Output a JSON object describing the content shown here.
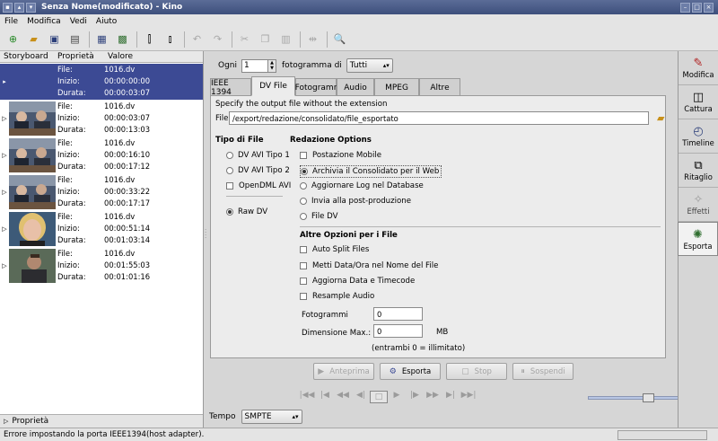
{
  "window": {
    "title": "Senza Nome(modificato) - Kino"
  },
  "menu": [
    "File",
    "Modifica",
    "Vedi",
    "Aiuto"
  ],
  "storyboard": {
    "headers": [
      "Storyboard",
      "Proprietà",
      "Valore"
    ],
    "labels": {
      "file": "File:",
      "start": "Inizio:",
      "dur": "Durata:"
    },
    "clips": [
      {
        "file": "1016.dv",
        "start": "00:00:00:00",
        "dur": "00:00:03:07",
        "thumb": "none",
        "selected": true
      },
      {
        "file": "1016.dv",
        "start": "00:00:03:07",
        "dur": "00:00:13:03",
        "thumb": "meeting"
      },
      {
        "file": "1016.dv",
        "start": "00:00:16:10",
        "dur": "00:00:17:12",
        "thumb": "meeting"
      },
      {
        "file": "1016.dv",
        "start": "00:00:33:22",
        "dur": "00:00:17:17",
        "thumb": "meeting"
      },
      {
        "file": "1016.dv",
        "start": "00:00:51:14",
        "dur": "00:01:03:14",
        "thumb": "woman"
      },
      {
        "file": "1016.dv",
        "start": "00:01:55:03",
        "dur": "00:01:01:16",
        "thumb": "man"
      }
    ],
    "footer": "Proprietà"
  },
  "controls": {
    "ogni_label": "Ogni",
    "ogni_value": "1",
    "frame_label": "fotogramma di",
    "frame_select": "Tutti"
  },
  "tabs": [
    "IEEE 1394",
    "DV File",
    "Fotogramr",
    "Audio",
    "MPEG",
    "Altre"
  ],
  "export": {
    "hint": "Specify the output file without the extension",
    "file_label": "File",
    "file_value": "/export/redazione/consolidato/file_esportato",
    "tipo_title": "Tipo di File",
    "tipo": [
      "DV AVI Tipo 1",
      "DV AVI Tipo 2"
    ],
    "opendml": "OpenDML AVI",
    "raw": "Raw DV",
    "red_title": "Redazione Options",
    "red_options": [
      "Postazione Mobile",
      "Archivia il Consolidato per il Web",
      "Aggiornare Log nel Database",
      "Invia alla post-produzione",
      "File DV"
    ],
    "altre_title": "Altre Opzioni per i File",
    "altre": [
      "Auto Split Files",
      "Metti Data/Ora nel Nome del File",
      "Aggiorna Data e Timecode",
      "Resample Audio"
    ],
    "fotogrammi_label": "Fotogrammi",
    "fotogrammi_value": "0",
    "dim_label": "Dimensione Max.:",
    "dim_value": "0",
    "dim_unit": "MB",
    "dim_note": "(entrambi 0 = illimitato)"
  },
  "buttons": {
    "anteprima": "Anteprima",
    "esporta": "Esporta",
    "stop": "Stop",
    "sospendi": "Sospendi"
  },
  "tempo": {
    "label": "Tempo",
    "value": "SMPTE"
  },
  "side": [
    "Modifica",
    "Cattura",
    "Timeline",
    "Ritaglio",
    "Effetti",
    "Esporta"
  ],
  "status": "Errore impostando la porta IEEE1394(host adapter)."
}
